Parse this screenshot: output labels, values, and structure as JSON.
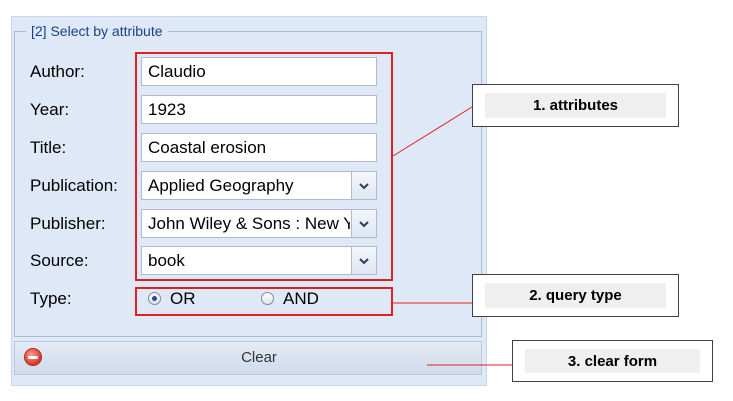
{
  "form": {
    "legend": "[2] Select by attribute",
    "fields": {
      "author": {
        "label": "Author:",
        "value": "Claudio"
      },
      "year": {
        "label": "Year:",
        "value": "1923"
      },
      "title": {
        "label": "Title:",
        "value": "Coastal erosion"
      },
      "publication": {
        "label": "Publication:",
        "value": "Applied Geography"
      },
      "publisher": {
        "label": "Publisher:",
        "value": "John Wiley & Sons : New Y"
      },
      "source": {
        "label": "Source:",
        "value": "book"
      }
    },
    "type": {
      "label": "Type:",
      "options": [
        {
          "label": "OR",
          "selected": true
        },
        {
          "label": "AND",
          "selected": false
        }
      ]
    },
    "clear_label": "Clear"
  },
  "annotations": {
    "attributes": "1. attributes",
    "query_type": "2. query type",
    "clear_form": "3.  clear form"
  },
  "colors": {
    "panel_bg": "#dfe8f6",
    "legend_text": "#15428b",
    "highlight_red": "#e02020"
  },
  "icons": {
    "combo_trigger": "chevron-down-icon",
    "clear": "minus-circle-icon"
  }
}
